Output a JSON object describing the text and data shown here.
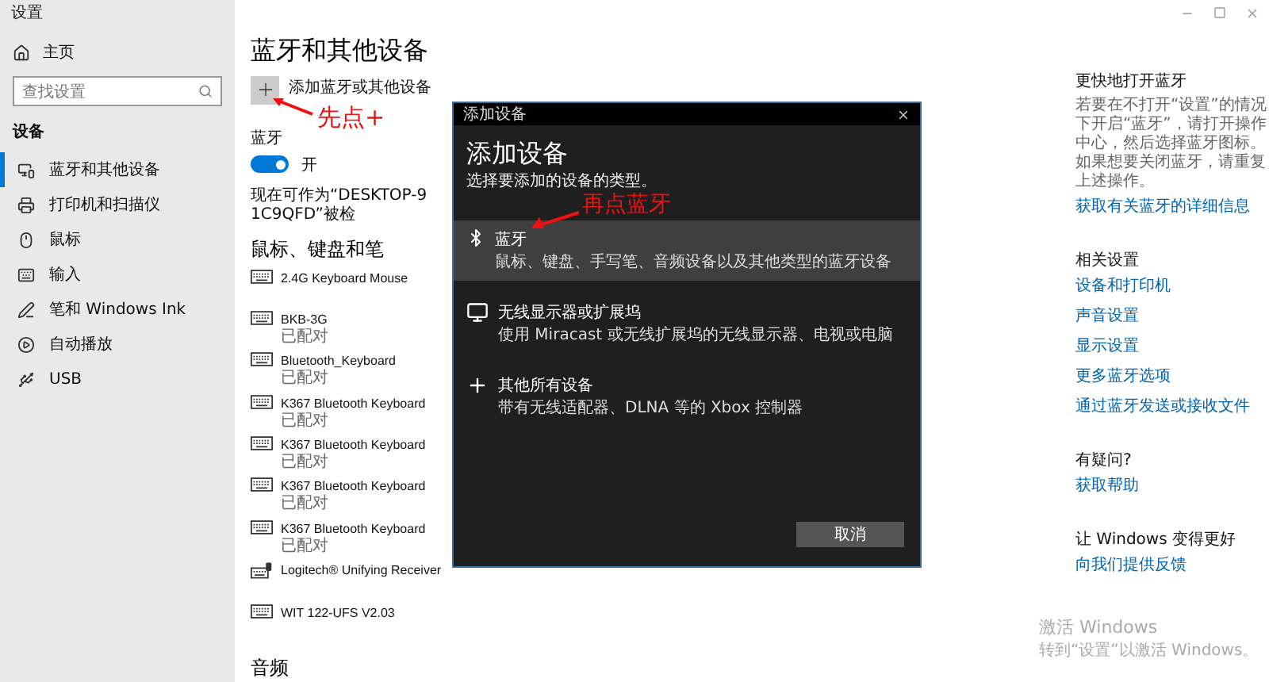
{
  "window": {
    "title": "设置"
  },
  "sidebar": {
    "home": "主页",
    "search": {
      "placeholder": "查找设置"
    },
    "section": "设备",
    "items": [
      {
        "label": "蓝牙和其他设备",
        "selected": true
      },
      {
        "label": "打印机和扫描仪",
        "selected": false
      },
      {
        "label": "鼠标",
        "selected": false
      },
      {
        "label": "输入",
        "selected": false
      },
      {
        "label": "笔和 Windows Ink",
        "selected": false
      },
      {
        "label": "自动播放",
        "selected": false
      },
      {
        "label": "USB",
        "selected": false
      }
    ]
  },
  "main": {
    "title": "蓝牙和其他设备",
    "add_label": "添加蓝牙或其他设备",
    "bluetooth": {
      "label": "蓝牙",
      "on": true,
      "state_text": "开"
    },
    "discoverable": "现在可作为“DESKTOP-91C9QFD”被检",
    "section": "鼠标、键盘和笔",
    "devices": [
      {
        "kind": "keyboard",
        "name": "2.4G Keyboard Mouse"
      },
      {
        "kind": "keyboard",
        "name": "BKB-3G",
        "status": "已配对"
      },
      {
        "kind": "keyboard",
        "name": "Bluetooth_Keyboard",
        "status": "已配对"
      },
      {
        "kind": "keyboard",
        "name": "K367 Bluetooth Keyboard",
        "status": "已配对"
      },
      {
        "kind": "keyboard",
        "name": "K367 Bluetooth Keyboard",
        "status": "已配对"
      },
      {
        "kind": "keyboard",
        "name": "K367 Bluetooth Keyboard",
        "status": "已配对"
      },
      {
        "kind": "keyboard",
        "name": "K367 Bluetooth Keyboard",
        "status": "已配对"
      },
      {
        "kind": "receiver",
        "name": "Logitech® Unifying Receiver"
      },
      {
        "kind": "keyboard",
        "name": "WIT 122-UFS V2.03"
      }
    ],
    "audio_section": "音频"
  },
  "dialog": {
    "window_title": "添加设备",
    "heading": "添加设备",
    "subtitle": "选择要添加的设备的类型。",
    "options": [
      {
        "kind": "bluetooth",
        "title": "蓝牙",
        "description": "鼠标、键盘、手写笔、音频设备以及其他类型的蓝牙设备",
        "selected": true
      },
      {
        "kind": "display",
        "title": "无线显示器或扩展坞",
        "description": "使用 Miracast 或无线扩展坞的无线显示器、电视或电脑",
        "selected": false
      },
      {
        "kind": "other",
        "title": "其他所有设备",
        "description": "带有无线适配器、DLNA 等的 Xbox 控制器",
        "selected": false
      }
    ],
    "cancel": "取消"
  },
  "annotations": [
    {
      "text": "先点+"
    },
    {
      "text": "再点蓝牙"
    }
  ],
  "right_panel": {
    "sections": [
      {
        "heading": "更快地打开蓝牙",
        "text": "若要在不打开“设置”的情况下开启“蓝牙”，请打开操作中心，然后选择蓝牙图标。如果想要关闭蓝牙，请重复上述操作。",
        "links": [
          "获取有关蓝牙的详细信息"
        ]
      },
      {
        "heading": "相关设置",
        "links": [
          "设备和打印机",
          "声音设置",
          "显示设置",
          "更多蓝牙选项",
          "通过蓝牙发送或接收文件"
        ]
      },
      {
        "heading": "有疑问?",
        "links": [
          "获取帮助"
        ]
      },
      {
        "heading": "让 Windows 变得更好",
        "links": [
          "向我们提供反馈"
        ]
      }
    ]
  },
  "activation": {
    "title": "激活 Windows",
    "text": "转到“设置”以激活 Windows。"
  }
}
